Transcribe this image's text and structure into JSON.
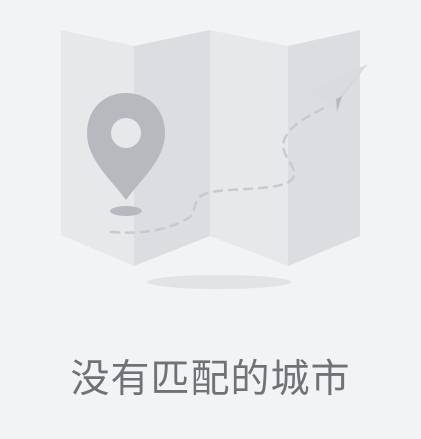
{
  "empty_state": {
    "message": "没有匹配的城市",
    "illustration_icon": "folded-map-icon",
    "location_icon": "map-pin-icon",
    "plane_icon": "paper-plane-icon"
  },
  "colors": {
    "background": "#f2f3f5",
    "map_light": "#e7e8ea",
    "map_dark": "#dcdde0",
    "pin": "#b6b9be",
    "text": "#6f7378"
  }
}
